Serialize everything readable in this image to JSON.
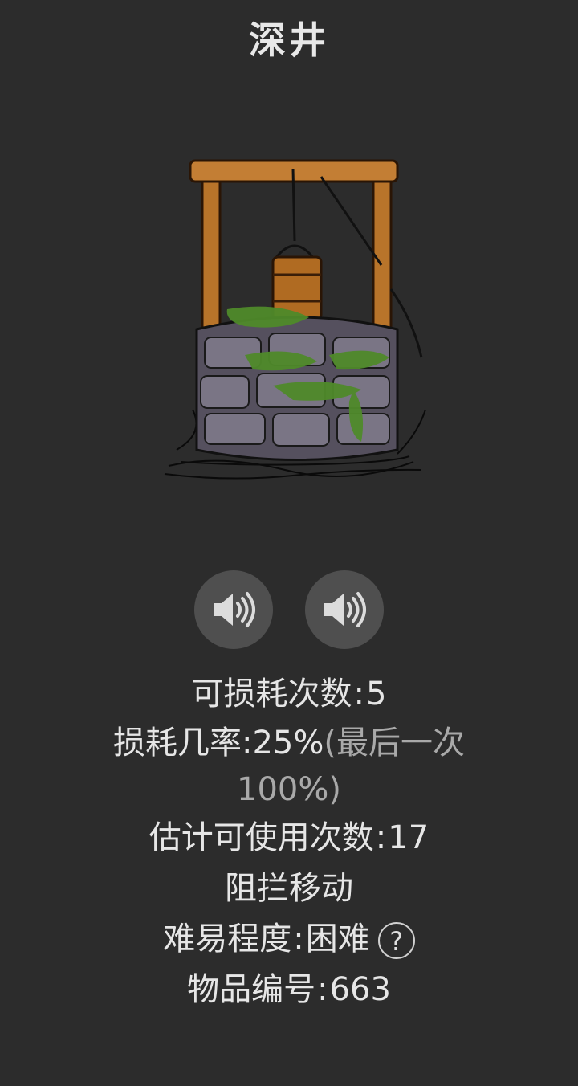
{
  "title": "深井",
  "sound_buttons": [
    {
      "icon": "speaker-icon"
    },
    {
      "icon": "speaker-icon"
    }
  ],
  "stats": {
    "wear_count_label": "可损耗次数",
    "wear_count_value": "5",
    "wear_rate_label": "损耗几率",
    "wear_rate_value": "25%",
    "wear_rate_note_1": "(最后一次",
    "wear_rate_note_2": "100%)",
    "estimated_uses_label": "估计可使用次数",
    "estimated_uses_value": "17",
    "blocks_movement": "阻拦移动",
    "difficulty_label": "难易程度",
    "difficulty_value": "困难",
    "help_symbol": "?",
    "item_id_label": "物品编号",
    "item_id_value": "663",
    "separator": ":"
  },
  "colors": {
    "background": "#2c2c2c",
    "text": "#e6e6e6",
    "muted_text": "#a9a9a9",
    "button_bg": "#4f4f4f"
  }
}
